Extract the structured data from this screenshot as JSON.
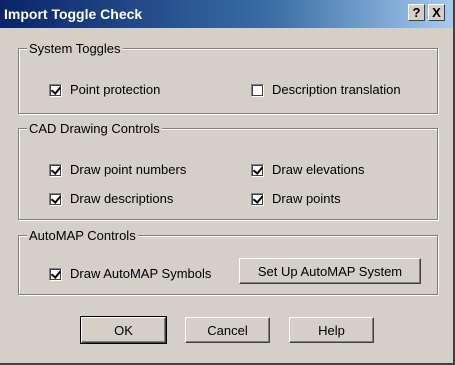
{
  "window": {
    "title": "Import Toggle Check",
    "help_label": "?",
    "close_label": "X"
  },
  "system_toggles": {
    "legend": "System Toggles",
    "items": [
      {
        "label": "Point protection",
        "checked": true
      },
      {
        "label": "Description translation",
        "checked": false
      }
    ]
  },
  "cad_controls": {
    "legend": "CAD Drawing Controls",
    "items": [
      {
        "label": "Draw point numbers",
        "checked": true
      },
      {
        "label": "Draw elevations",
        "checked": true
      },
      {
        "label": "Draw descriptions",
        "checked": true
      },
      {
        "label": "Draw points",
        "checked": true
      }
    ]
  },
  "automap": {
    "legend": "AutoMAP Controls",
    "item": {
      "label": "Draw AutoMAP Symbols",
      "checked": true
    },
    "setup_button": "Set Up AutoMAP System"
  },
  "buttons": {
    "ok": "OK",
    "cancel": "Cancel",
    "help": "Help"
  }
}
